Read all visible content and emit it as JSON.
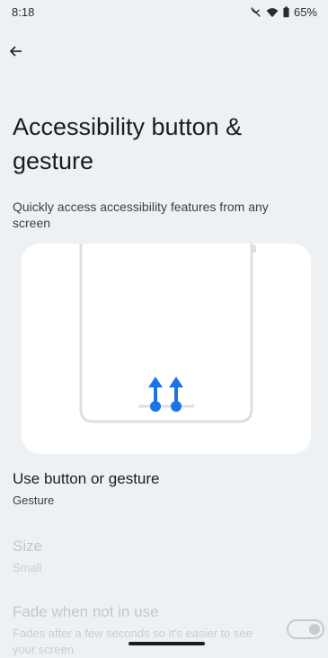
{
  "status_bar": {
    "time": "8:18",
    "battery": "65%",
    "icons": [
      "do-not-disturb-icon",
      "wifi-icon",
      "battery-icon"
    ]
  },
  "header": {
    "back_icon": "back-arrow-icon",
    "title": "Accessibility button & gesture",
    "subtitle": "Quickly access accessibility features from any screen"
  },
  "illustration": {
    "description_icon": "two-finger-swipe-up-icon",
    "accent_color": "#1a73e8"
  },
  "settings": {
    "gesture": {
      "title": "Use button or gesture",
      "summary": "Gesture"
    },
    "size": {
      "title": "Size",
      "summary": "Small"
    },
    "fade": {
      "title": "Fade when not in use",
      "summary": "Fades after a few seconds so it's easier to see your screen",
      "enabled": false
    }
  }
}
